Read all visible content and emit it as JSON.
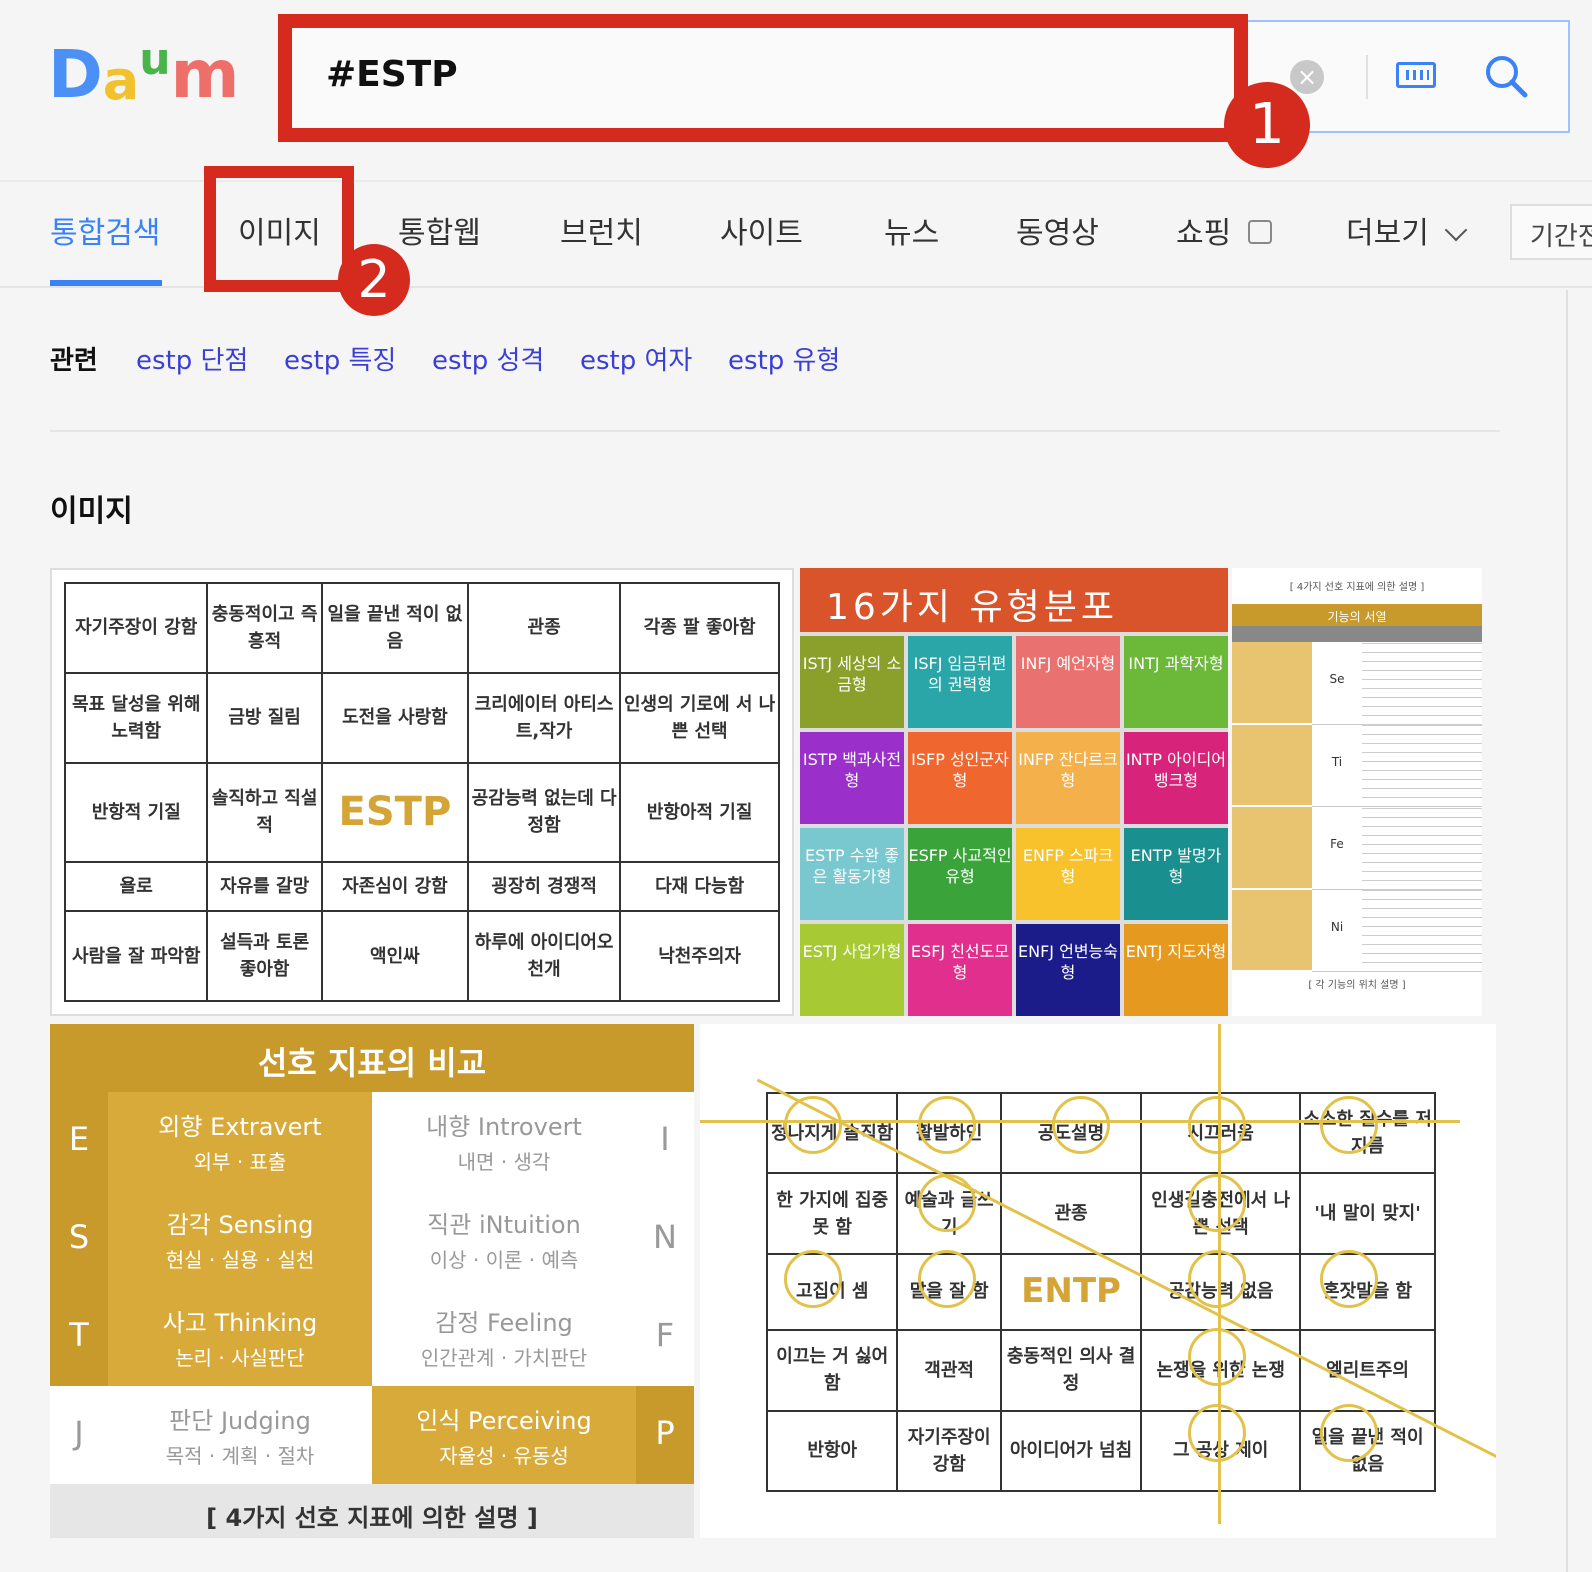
{
  "logo": {
    "letters": [
      "D",
      "a",
      "u",
      "m"
    ],
    "colors": [
      "#4a90f5",
      "#f2c12e",
      "#49b44a",
      "#ee6f6a"
    ]
  },
  "search": {
    "query": "#ESTP",
    "clear_icon": "clear-icon",
    "keyboard_icon": "keyboard-icon",
    "search_icon": "search-icon"
  },
  "badges": {
    "one": "1",
    "two": "2"
  },
  "tabs": [
    {
      "label": "통합검색",
      "active": true
    },
    {
      "label": "이미지",
      "active": false
    },
    {
      "label": "통합웹",
      "active": false
    },
    {
      "label": "브런치",
      "active": false
    },
    {
      "label": "사이트",
      "active": false
    },
    {
      "label": "뉴스",
      "active": false
    },
    {
      "label": "동영상",
      "active": false
    },
    {
      "label": "쇼핑",
      "active": false
    },
    {
      "label": "더보기",
      "active": false
    }
  ],
  "period_label": "기간전",
  "related": {
    "label": "관련",
    "links": [
      "estp 단점",
      "estp 특징",
      "estp 성격",
      "estp 여자",
      "estp 유형"
    ]
  },
  "section_title": "이미지",
  "image1": {
    "rows": [
      [
        "자기주장이 강함",
        "충동적이고 즉흥적",
        "일을 끝낸 적이 없음",
        "관종",
        "각종 팔 좋아함"
      ],
      [
        "목표 달성을 위해 노력함",
        "금방 질림",
        "도전을 사랑함",
        "크리에이터 아티스트,작가",
        "인생의 기로에 서 나쁜 선택"
      ],
      [
        "반항적 기질",
        "솔직하고 직설적",
        "ESTP",
        "공감능력 없는데 다정함",
        "반항아적 기질"
      ],
      [
        "욜로",
        "자유를 갈망",
        "자존심이 강함",
        "굉장히 경쟁적",
        "다재 다능함"
      ],
      [
        "사람을 잘 파악함",
        "설득과 토론 좋아함",
        "액인싸",
        "하루에 아이디어오천개",
        "낙천주의자"
      ]
    ]
  },
  "image2": {
    "title": "16가지 유형분포",
    "cells": [
      {
        "t": "ISTJ 세상의 소금형",
        "c": "#8aa02a"
      },
      {
        "t": "ISFJ 임금뒤편의 권력형",
        "c": "#2ba6a8"
      },
      {
        "t": "INFJ 예언자형",
        "c": "#e9716f"
      },
      {
        "t": "INTJ 과학자형",
        "c": "#6cb839"
      },
      {
        "t": "ISTP 백과사전형",
        "c": "#9b2fc9"
      },
      {
        "t": "ISFP 성인군자형",
        "c": "#f0662f"
      },
      {
        "t": "INFP 잔다르크형",
        "c": "#f4b04a"
      },
      {
        "t": "INTP 아이디어 뱅크형",
        "c": "#d8237b"
      },
      {
        "t": "ESTP 수완 좋은 활동가형",
        "c": "#79c7cf"
      },
      {
        "t": "ESFP 사교적인 유형",
        "c": "#3aa33a"
      },
      {
        "t": "ENFP 스파크형",
        "c": "#f7c22c"
      },
      {
        "t": "ENTP 발명가형",
        "c": "#1a8f8f"
      },
      {
        "t": "ESTJ 사업가형",
        "c": "#a7c934"
      },
      {
        "t": "ESFJ 친선도모형",
        "c": "#e12f8d"
      },
      {
        "t": "ENFJ 언변능숙형",
        "c": "#1b1b8a"
      },
      {
        "t": "ENTJ 지도자형",
        "c": "#e59a1f"
      }
    ]
  },
  "image3": {
    "header": "[ 4가지 선호 지표에 의한 설명 ]",
    "band": "기능의 서열",
    "rows": [
      "Se",
      "Ti",
      "Fe",
      "Ni"
    ],
    "footer": "[ 각 기능의 위치 설명 ]"
  },
  "image4": {
    "title": "선호 지표의 비교",
    "rows": [
      {
        "l": "E",
        "a": "외향 Extravert",
        "as": "외부 · 표출",
        "b": "내향 Introvert",
        "bs": "내면 · 생각",
        "r": "I",
        "gold_left": true
      },
      {
        "l": "S",
        "a": "감각 Sensing",
        "as": "현실 · 실용 · 실천",
        "b": "직관 iNtuition",
        "bs": "이상 · 이론 · 예측",
        "r": "N",
        "gold_left": true
      },
      {
        "l": "T",
        "a": "사고 Thinking",
        "as": "논리 · 사실판단",
        "b": "감정 Feeling",
        "bs": "인간관계 · 가치판단",
        "r": "F",
        "gold_left": true
      },
      {
        "l": "J",
        "a": "판단 Judging",
        "as": "목적 · 계획 · 절차",
        "b": "인식 Perceiving",
        "bs": "자율성 · 유동성",
        "r": "P",
        "gold_left": false
      }
    ],
    "footer": "[ 4가지 선호 지표에 의한 설명 ]"
  },
  "image5": {
    "rows": [
      [
        "정나지게 솔직함",
        "활발하인",
        "공도설명",
        "시끄러움",
        "소소한 질수를 저지름"
      ],
      [
        "한 가지에 집중 못 함",
        "예술과 글쓰기",
        "관종",
        "인생길충전에서 나쁜 선택",
        "'내 말이 맞지'"
      ],
      [
        "고집이 셈",
        "말을 잘 함",
        "ENTP",
        "공감능력 없음",
        "혼잣말을 함"
      ],
      [
        "이끄는 거 싫어함",
        "객관적",
        "충동적인 의사 결정",
        "논쟁을 위한 논쟁",
        "엘리트주의"
      ],
      [
        "반항아",
        "자기주장이 강함",
        "아이디어가 넘침",
        "그 공상 제이",
        "일을 끝낸 적이 없음"
      ]
    ]
  }
}
